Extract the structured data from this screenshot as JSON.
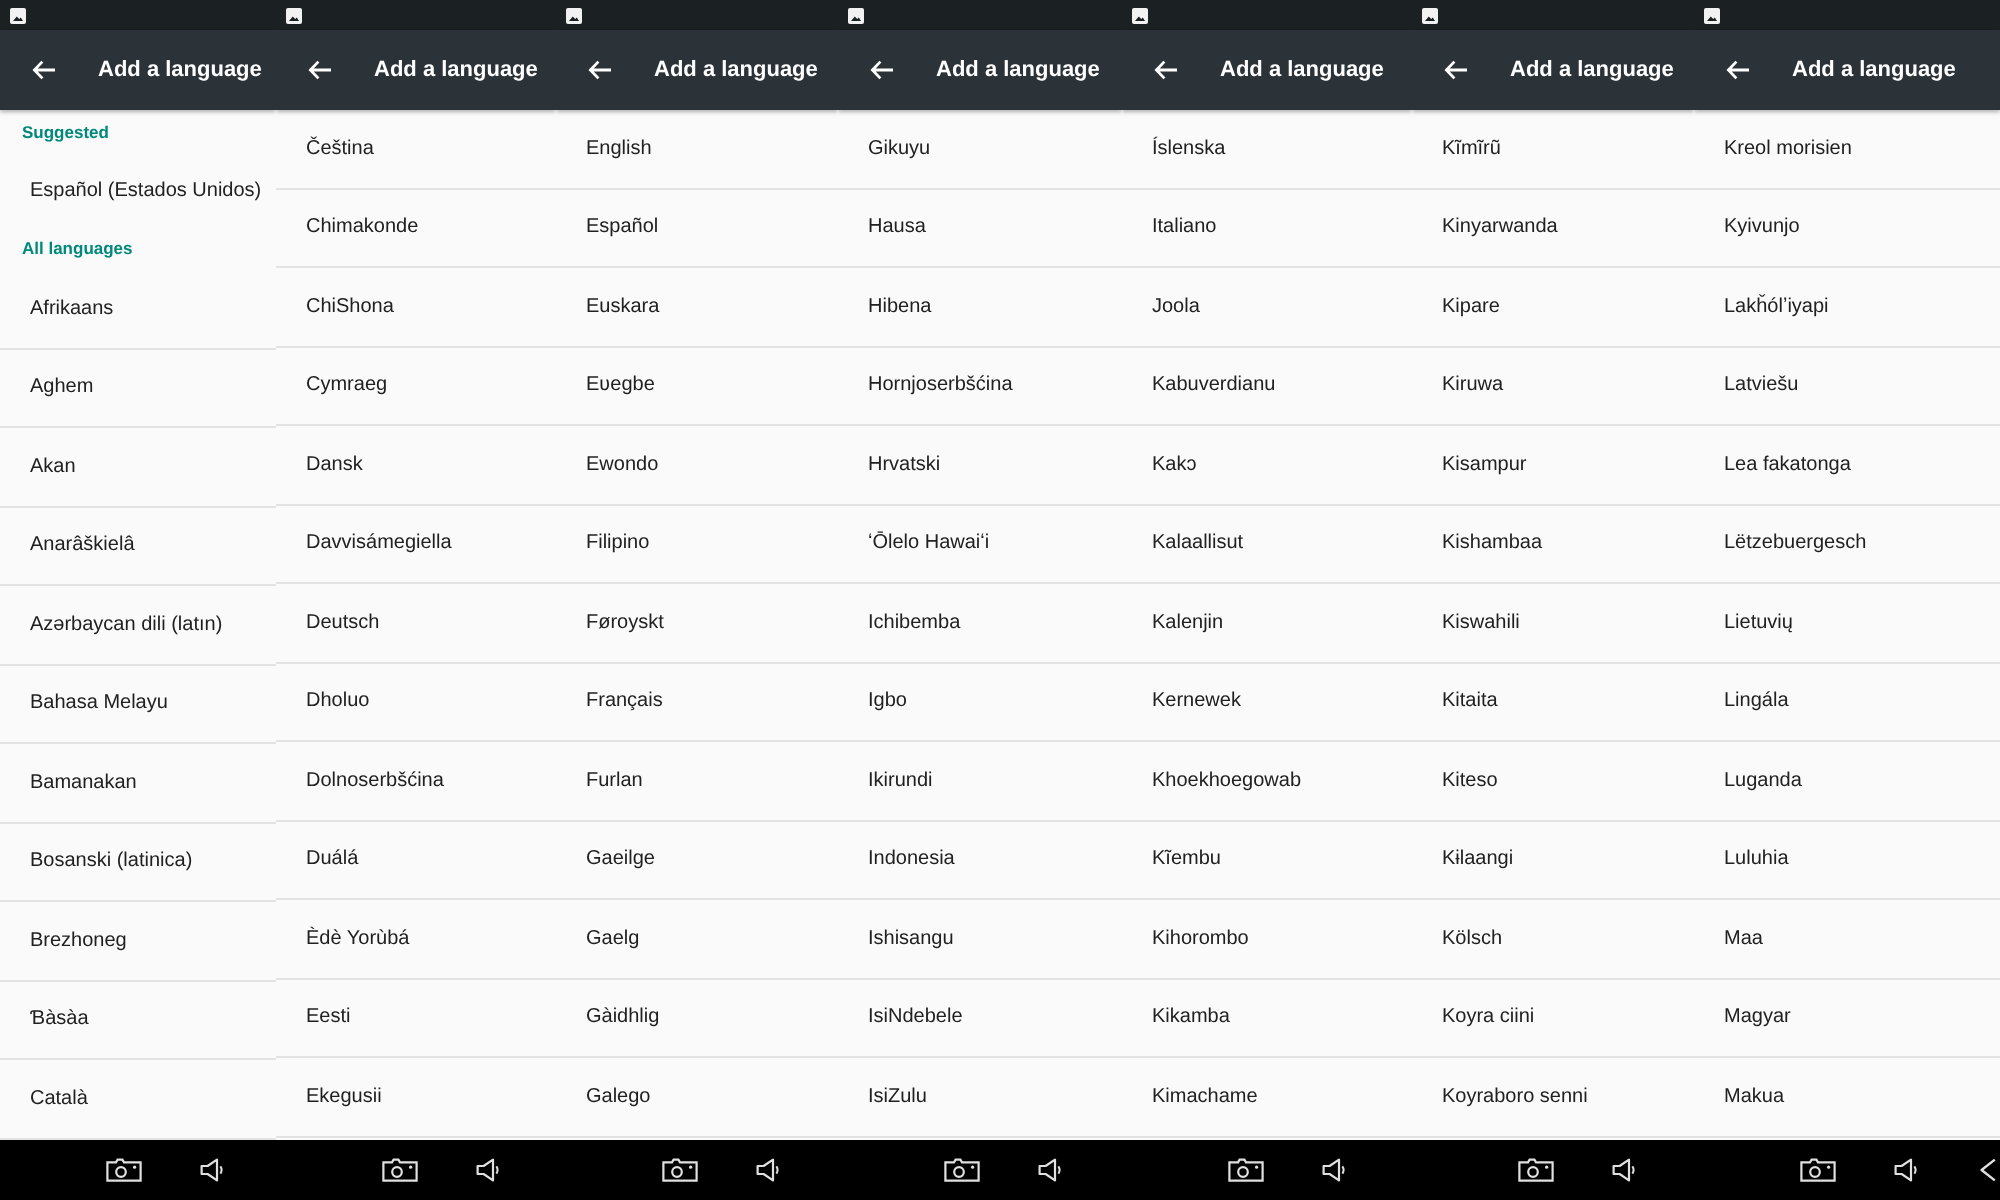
{
  "screens": [
    {
      "title": "Add a language",
      "sections": [
        {
          "header": "Suggested",
          "items": [
            "Español (Estados Unidos)"
          ]
        },
        {
          "header": "All languages",
          "items": [
            "Afrikaans",
            "Aghem",
            "Akan",
            "Anarâškielâ",
            "Azərbaycan dili (latın)",
            "Bahasa Melayu",
            "Bamanakan",
            "Bosanski (latinica)",
            "Brezhoneg",
            "Ɓàsàa",
            "Català"
          ]
        }
      ]
    },
    {
      "title": "Add a language",
      "sections": [
        {
          "items": [
            "Čeština",
            "Chimakonde",
            "ChiShona",
            "Cymraeg",
            "Dansk",
            "Davvisámegiella",
            "Deutsch",
            "Dholuo",
            "Dolnoserbšćina",
            "Duálá",
            "Èdè Yorùbá",
            "Eesti",
            "Ekegusii"
          ]
        }
      ]
    },
    {
      "title": "Add a language",
      "sections": [
        {
          "items": [
            "English",
            "Español",
            "Euskara",
            "Eʋegbe",
            "Ewondo",
            "Filipino",
            "Føroyskt",
            "Français",
            "Furlan",
            "Gaeilge",
            "Gaelg",
            "Gàidhlig",
            "Galego"
          ]
        }
      ]
    },
    {
      "title": "Add a language",
      "sections": [
        {
          "items": [
            "Gikuyu",
            "Hausa",
            "Hibena",
            "Hornjoserbšćina",
            "Hrvatski",
            "ʻŌlelo Hawaiʻi",
            "Ichibemba",
            "Igbo",
            "Ikirundi",
            "Indonesia",
            "Ishisangu",
            "IsiNdebele",
            "IsiZulu"
          ]
        }
      ]
    },
    {
      "title": "Add a language",
      "sections": [
        {
          "items": [
            "Íslenska",
            "Italiano",
            "Joola",
            "Kabuverdianu",
            "Kakɔ",
            "Kalaallisut",
            "Kalenjin",
            "Kernewek",
            "Khoekhoegowab",
            "Kĩembu",
            "Kihorombo",
            "Kikamba",
            "Kimachame"
          ]
        }
      ]
    },
    {
      "title": "Add a language",
      "sections": [
        {
          "items": [
            "Kĩmĩrũ",
            "Kinyarwanda",
            "Kipare",
            "Kiruwa",
            "Kisampur",
            "Kishambaa",
            "Kiswahili",
            "Kitaita",
            "Kiteso",
            "Kɨlaangi",
            "Kölsch",
            "Koyra ciini",
            "Koyraboro senni"
          ]
        }
      ]
    },
    {
      "title": "Add a language",
      "sections": [
        {
          "items": [
            "Kreol morisien",
            "Kyivunjo",
            "Lakȟólʼiyapi",
            "Latviešu",
            "Lea fakatonga",
            "Lëtzebuergesch",
            "Lietuvių",
            "Lingála",
            "Luganda",
            "Luluhia",
            "Maa",
            "Magyar",
            "Makua"
          ]
        }
      ]
    }
  ]
}
